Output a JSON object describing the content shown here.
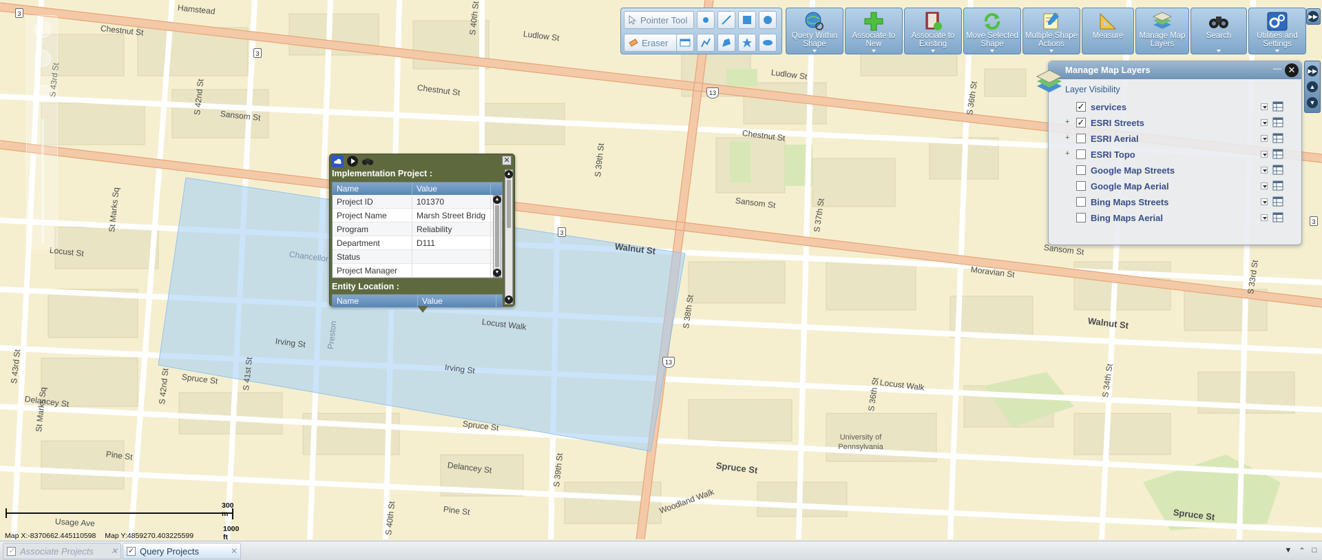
{
  "toolbar": {
    "pointer_tool": "Pointer Tool",
    "eraser": "Eraser",
    "buttons": [
      {
        "label": "Query Within Shape",
        "icon": "globe-search-icon"
      },
      {
        "label": "Associate to New",
        "icon": "plus-icon"
      },
      {
        "label": "Associate to Existing",
        "icon": "book-add-icon"
      },
      {
        "label": "Move Selected Shape",
        "icon": "refresh-arrows-icon"
      },
      {
        "label": "Multiple Shape Actions",
        "icon": "notepad-pencil-icon"
      },
      {
        "label": "Measure",
        "icon": "ruler-triangle-icon"
      },
      {
        "label": "Manage Map Layers",
        "icon": "layers-icon"
      },
      {
        "label": "Search",
        "icon": "binoculars-icon"
      },
      {
        "label": "Utilities and Settings",
        "icon": "gears-icon"
      }
    ]
  },
  "layers_panel": {
    "title": "Manage Map Layers",
    "visibility_label": "Layer Visibility",
    "layers": [
      {
        "name": "services",
        "checked": true,
        "expandable": false
      },
      {
        "name": "ESRI Streets",
        "checked": true,
        "expandable": true
      },
      {
        "name": "ESRI Aerial",
        "checked": false,
        "expandable": true
      },
      {
        "name": "ESRI Topo",
        "checked": false,
        "expandable": true
      },
      {
        "name": "Google Map Streets",
        "checked": false,
        "expandable": false
      },
      {
        "name": "Google Map Aerial",
        "checked": false,
        "expandable": false
      },
      {
        "name": "Bing Maps Streets",
        "checked": false,
        "expandable": false
      },
      {
        "name": "Bing Maps Aerial",
        "checked": false,
        "expandable": false
      }
    ]
  },
  "popup": {
    "project_title": "Implementation Project :",
    "col_name": "Name",
    "col_value": "Value",
    "rows": [
      {
        "name": "Project ID",
        "value": "101370"
      },
      {
        "name": "Project Name",
        "value": "Marsh Street Bridg"
      },
      {
        "name": "Program",
        "value": "Reliability"
      },
      {
        "name": "Department",
        "value": "D111"
      },
      {
        "name": "Status",
        "value": ""
      },
      {
        "name": "Project Manager",
        "value": ""
      }
    ],
    "entity_title": "Entity Location :"
  },
  "map": {
    "streets": {
      "chestnut": "Chestnut St",
      "ludlow": "Ludlow St",
      "sansom": "Sansom St",
      "walnut": "Walnut St",
      "locust": "Locust St",
      "locust_walk": "Locust Walk",
      "irving": "Irving St",
      "spruce": "Spruce St",
      "delancey": "Delancey St",
      "pine": "Pine St",
      "woodland": "Woodland Walk",
      "moravian": "Moravian St",
      "s38": "S 38th St",
      "s39": "S 39th St",
      "s40": "S 40th St",
      "s41": "S 41st St",
      "s42": "S 42nd St",
      "s43": "S 43rd St",
      "s37": "S 37th St",
      "s36": "S 36th St",
      "s34": "S 34th St",
      "s33": "S 33rd St",
      "stmarks": "St Marks Sq",
      "preston": "Preston",
      "chancellor": "Chancellor",
      "usage": "Usage Ave",
      "hamstead": "Hamstead"
    },
    "poi": "University of Pennsylvania",
    "route_13": "13",
    "route_3": "3"
  },
  "scale": {
    "metric": "300 m",
    "imperial": "1000 ft"
  },
  "coords": {
    "x": "Map X:-8370662.445110598",
    "y": "Map Y:4859270.403225599"
  },
  "tabs": [
    {
      "label": "Associate Projects",
      "active": false
    },
    {
      "label": "Query Projects",
      "active": true
    }
  ]
}
